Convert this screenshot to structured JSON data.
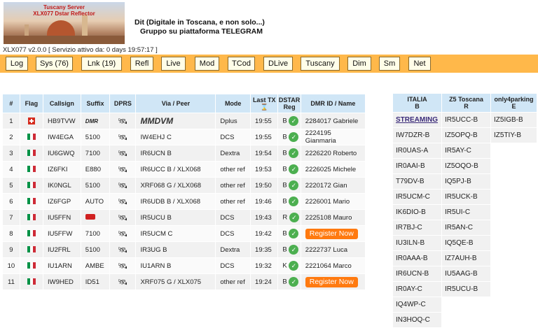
{
  "banner": {
    "line1": "Tuscany Server",
    "line2": "XLX077 Dstar Reflector"
  },
  "headline": {
    "line1": "Dit (Digitale in Toscana, e non solo...)",
    "line2": "Gruppo su piattaforma TELEGRAM"
  },
  "status": "XLX077 v2.0.0 [ Servizio attivo da: 0 days 19:57:17 ]",
  "nav": [
    "Log",
    "Sys (76)",
    "Lnk (19)",
    "Refl",
    "Live",
    "Mod",
    "TCod",
    "DLive",
    "Tuscany",
    "Dim",
    "Sm",
    "Net"
  ],
  "columns": [
    "#",
    "Flag",
    "Callsign",
    "Suffix",
    "DPRS",
    "Via / Peer",
    "Mode",
    "Last TX",
    "DSTAR Reg",
    "DMR ID / Name"
  ],
  "last_tx_icon": "hourglass-icon",
  "rows": [
    {
      "n": "1",
      "flag": "ch",
      "call": "HB9TVW",
      "suffix": "DMR",
      "via": "MMDVM",
      "mode": "Dplus",
      "tx": "19:55",
      "mod": "B",
      "dmr1": "2284017 Gabriele",
      "dmr2": ""
    },
    {
      "n": "2",
      "flag": "it",
      "call": "IW4EGA",
      "suffix": "5100",
      "via": "IW4EHJ C",
      "mode": "DCS",
      "tx": "19:55",
      "mod": "B",
      "dmr1": "2224195",
      "dmr2": "Gianmaria"
    },
    {
      "n": "3",
      "flag": "it",
      "call": "IU6GWQ",
      "suffix": "7100",
      "via": "IR6UCN B",
      "mode": "Dextra",
      "tx": "19:54",
      "mod": "B",
      "dmr1": "2226220 Roberto",
      "dmr2": ""
    },
    {
      "n": "4",
      "flag": "it",
      "call": "IZ6FKI",
      "suffix": "E880",
      "via": "IR6UCC B / XLX068",
      "mode": "other ref",
      "tx": "19:53",
      "mod": "B",
      "dmr1": "2226025 Michele",
      "dmr2": ""
    },
    {
      "n": "5",
      "flag": "it",
      "call": "IK0NGL",
      "suffix": "5100",
      "via": "XRF068 G / XLX068",
      "mode": "other ref",
      "tx": "19:50",
      "mod": "B",
      "dmr1": "2220172 Gian",
      "dmr2": ""
    },
    {
      "n": "6",
      "flag": "it",
      "call": "IZ6FGP",
      "suffix": "AUTO",
      "via": "IR6UDB B / XLX068",
      "mode": "other ref",
      "tx": "19:46",
      "mod": "B",
      "dmr1": "2226001 Mario",
      "dmr2": ""
    },
    {
      "n": "7",
      "flag": "it",
      "call": "IU5FFN",
      "suffix": "",
      "via": "IR5UCU B",
      "mode": "DCS",
      "tx": "19:43",
      "mod": "R",
      "dmr1": "2225108 Mauro",
      "dmr2": ""
    },
    {
      "n": "8",
      "flag": "it",
      "call": "IU5FFW",
      "suffix": "7100",
      "via": "IR5UCM C",
      "mode": "DCS",
      "tx": "19:42",
      "mod": "B",
      "dmr1": "Register Now",
      "dmr2": ""
    },
    {
      "n": "9",
      "flag": "it",
      "call": "IU2FRL",
      "suffix": "5100",
      "via": "IR3UG B",
      "mode": "Dextra",
      "tx": "19:35",
      "mod": "B",
      "dmr1": "2222737 Luca",
      "dmr2": ""
    },
    {
      "n": "10",
      "flag": "it",
      "call": "IU1ARN",
      "suffix": "AMBE",
      "via": "IU1ARN B",
      "mode": "DCS",
      "tx": "19:32",
      "mod": "K",
      "dmr1": "2221064 Marco",
      "dmr2": ""
    },
    {
      "n": "11",
      "flag": "it",
      "call": "IW9HED",
      "suffix": "ID51",
      "via": "XRF075 G / XLX075",
      "mode": "other ref",
      "tx": "19:24",
      "mod": "B",
      "dmr1": "Register Now",
      "dmr2": ""
    }
  ],
  "side": {
    "headers": [
      {
        "line1": "ITALIA",
        "line2": "B"
      },
      {
        "line1": "Z5 Toscana",
        "line2": "R"
      },
      {
        "line1": "only4parking",
        "line2": "E"
      }
    ],
    "col1": [
      "STREAMING",
      "IW7DZR-B",
      "IR0UAS-A",
      "IR0AAI-B",
      "T79DV-B",
      "IR5UCM-C",
      "IK6DIO-B",
      "IR7BJ-C",
      "IU3ILN-B",
      "IR0AAA-B",
      "IR6UCN-B",
      "IR0AY-C",
      "IQ4WP-C",
      "IN3HOQ-C"
    ],
    "col2": [
      "IR5UCC-B",
      "IZ5OPQ-B",
      "IR5AY-C",
      "IZ5OQO-B",
      "IQ5PJ-B",
      "IR5UCK-B",
      "IR5UI-C",
      "IR5AN-C",
      "IQ5QE-B",
      "IZ7AUH-B",
      "IU5AAG-B",
      "IR5UCU-B"
    ],
    "col3": [
      "IZ5IGB-B",
      "IZ5TIY-B"
    ]
  }
}
